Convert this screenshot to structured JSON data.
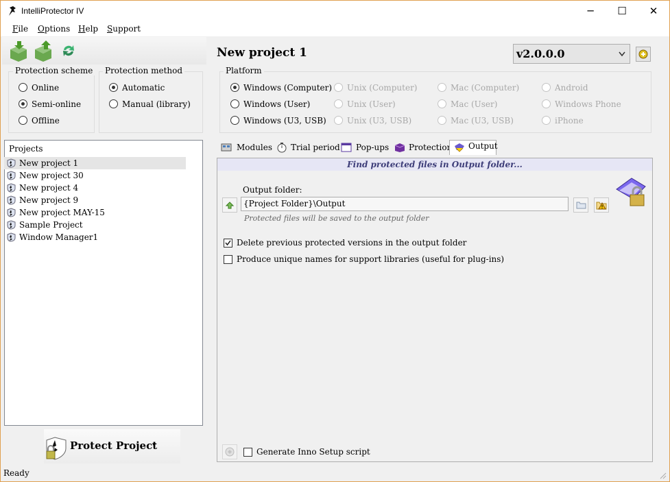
{
  "window": {
    "title": "IntelliProtector IV",
    "controls": [
      "─",
      "☐",
      "✕"
    ]
  },
  "menu": {
    "items": [
      {
        "label": "File",
        "accel": "F",
        "rest": "ile"
      },
      {
        "label": "Options",
        "accel": "O",
        "rest": "ptions"
      },
      {
        "label": "Help",
        "accel": "H",
        "rest": "elp"
      },
      {
        "label": "Support",
        "accel": "S",
        "rest": "upport"
      }
    ]
  },
  "toolbar": {
    "icons": [
      "import-box-icon",
      "export-box-icon",
      "refresh-icon"
    ]
  },
  "protection_scheme": {
    "title": "Protection scheme",
    "options": [
      "Online",
      "Semi-online",
      "Offline"
    ],
    "selected": "Semi-online"
  },
  "protection_method": {
    "title": "Protection method",
    "options": [
      "Automatic",
      "Manual (library)"
    ],
    "selected": "Automatic"
  },
  "projects": {
    "header": "Projects",
    "items": [
      "New project 1",
      "New project 30",
      "New project 4",
      "New project 9",
      "New project MAY-15",
      "Sample Project",
      "Window Manager1"
    ],
    "selected": "New project 1"
  },
  "protect_button": {
    "label": "Protect Project",
    "arrow": "▾"
  },
  "project": {
    "title": "New project 1",
    "version": "v2.0.0.0"
  },
  "platform": {
    "title": "Platform",
    "options": [
      {
        "label": "Windows (Computer)",
        "enabled": true,
        "checked": true
      },
      {
        "label": "Unix (Computer)",
        "enabled": false,
        "checked": false
      },
      {
        "label": "Mac (Computer)",
        "enabled": false,
        "checked": false
      },
      {
        "label": "Android",
        "enabled": false,
        "checked": false
      },
      {
        "label": "Windows (User)",
        "enabled": true,
        "checked": false
      },
      {
        "label": "Unix (User)",
        "enabled": false,
        "checked": false
      },
      {
        "label": "Mac (User)",
        "enabled": false,
        "checked": false
      },
      {
        "label": "Windows Phone",
        "enabled": false,
        "checked": false
      },
      {
        "label": "Windows (U3, USB)",
        "enabled": true,
        "checked": false
      },
      {
        "label": "Unix (U3, USB)",
        "enabled": false,
        "checked": false
      },
      {
        "label": "Mac (U3, USB)",
        "enabled": false,
        "checked": false
      },
      {
        "label": "iPhone",
        "enabled": false,
        "checked": false
      }
    ]
  },
  "tabs": {
    "items": [
      "Modules",
      "Trial period",
      "Pop-ups",
      "Protection",
      "Output"
    ],
    "active": "Output"
  },
  "output": {
    "banner": "Find protected files in Output folder...",
    "folder_label": "Output folder:",
    "folder_value": "{Project Folder}\\Output",
    "hint": "Protected files will be saved to the output folder",
    "delete_previous_label": "Delete previous protected versions in the output folder",
    "delete_previous_checked": true,
    "unique_names_label": "Produce unique names for support libraries (useful for plug-ins)",
    "unique_names_checked": false,
    "inno_label": "Generate Inno Setup script",
    "inno_checked": false
  },
  "status": {
    "text": "Ready"
  },
  "colors": {
    "banner_bg": "#e6e6f5",
    "banner_text": "#3c3c78",
    "window_border": "#e0a050"
  }
}
